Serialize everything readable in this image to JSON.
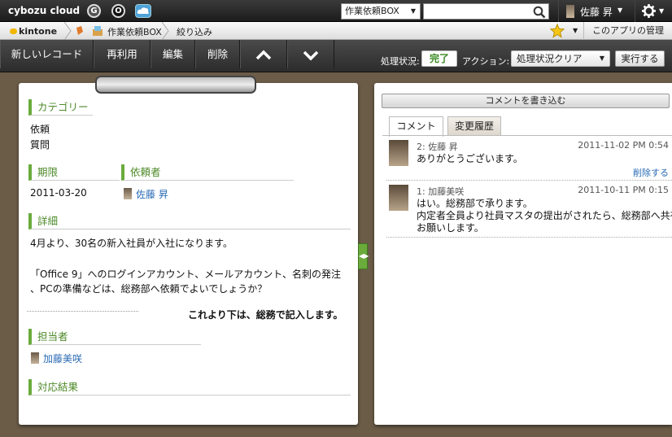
{
  "topbar": {
    "brand": "cybozu cloud",
    "app_icons": [
      "G",
      "O",
      "S"
    ],
    "space_select": "作業依頼BOX",
    "search_value": "",
    "user_name": "佐藤 昇"
  },
  "breadcrumb": {
    "root": "kintone",
    "app": "作業依頼BOX",
    "current": "絞り込み",
    "manage": "このアプリの管理"
  },
  "toolbar": {
    "new_record": "新しいレコード",
    "reuse": "再利用",
    "edit": "編集",
    "delete": "削除",
    "status_label": "処理状況:",
    "status_value": "完了",
    "action_label": "アクション:",
    "action_value": "処理状況クリア",
    "execute": "実行する"
  },
  "record": {
    "category_label": "カテゴリー",
    "category_values": [
      "依頼",
      "質問"
    ],
    "deadline_label": "期限",
    "deadline_value": "2011-03-20",
    "requester_label": "依頼者",
    "requester_value": "佐藤 昇",
    "detail_label": "詳細",
    "detail_lines": [
      "4月より、30名の新入社員が入社になります。",
      "「Office 9」へのログインアカウント、メールアカウント、名刺の発注",
      "、PCの準備などは、総務部へ依頼でよいでしょうか？"
    ],
    "note": "これより下は、総務で記入します。",
    "assignee_label": "担当者",
    "assignee_value": "加藤美咲",
    "result_label": "対応結果"
  },
  "comments_panel": {
    "write_button": "コメントを書き込む",
    "tabs": [
      "コメント",
      "変更履歴"
    ],
    "comments": [
      {
        "header": "2: 佐藤 昇",
        "date": "2011-11-02 PM 0:54",
        "lines": [
          "ありがとうございます。"
        ],
        "delete": "削除する"
      },
      {
        "header": "1: 加藤美咲",
        "date": "2011-10-11 PM 0:15",
        "lines": [
          "はい。総務部で承ります。",
          "内定者全員より社員マスタの提出がされたら、総務部へ共有",
          "お願いします。"
        ]
      }
    ]
  },
  "colors": {
    "section_green": "#4e8a2a",
    "status_done": "#3a8a22",
    "link": "#2a6bb5"
  }
}
